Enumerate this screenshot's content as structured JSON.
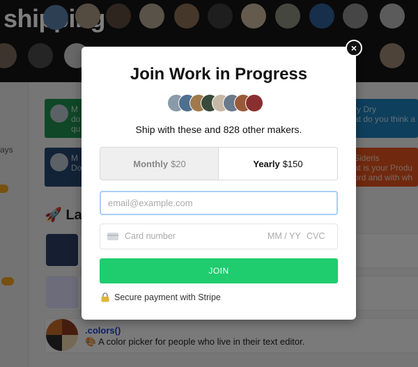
{
  "background": {
    "title": "shipping",
    "side_text": "ays",
    "cards": [
      {
        "line1": "M",
        "line2": "do",
        "line3": "qu",
        "color": "#1e8f4e"
      },
      {
        "line1": "M",
        "line2": "Do",
        "line3": "",
        "color": "#24466e"
      },
      {
        "line1": "ry Dry",
        "line2": "at do you think a",
        "color": "#1c7fb8"
      },
      {
        "line1": "Sideris",
        "line2": "at is your Produ",
        "line3": "ord and with wh",
        "color": "#e0521c"
      }
    ],
    "section_heading": "🚀 Lau",
    "product": {
      "name": ".colors()",
      "description": "🎨 A color picker for people who live in their text editor."
    }
  },
  "modal": {
    "close_label": "×",
    "title": "Join Work in Progress",
    "subtitle": "Ship with these and 828 other makers.",
    "plans": [
      {
        "name": "Monthly",
        "price": "$20",
        "selected": false
      },
      {
        "name": "Yearly",
        "price": "$150",
        "selected": true
      }
    ],
    "email_placeholder": "email@example.com",
    "card": {
      "number_placeholder": "Card number",
      "expiry_placeholder": "MM / YY",
      "cvc_placeholder": "CVC",
      "icon": "credit-card-icon"
    },
    "join_label": "JOIN",
    "secure_text": "Secure payment with Stripe",
    "accent_color": "#1fcc6e"
  }
}
